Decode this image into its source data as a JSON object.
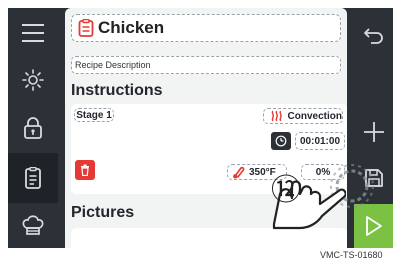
{
  "recipe": {
    "title": "Chicken",
    "description": "Recipe Description"
  },
  "instructions": {
    "heading": "Instructions",
    "stage_label": "Stage 1",
    "mode_label": "Convection",
    "time_value": "00:01:00",
    "temp_value": "350°F",
    "fan_value": "0%"
  },
  "pictures": {
    "heading": "Pictures"
  },
  "callout": {
    "number": "⑫"
  },
  "watermark": "VMC-TS-01680",
  "colors": {
    "background_dark": "#2c3138",
    "panel": "#f2f3f3",
    "accent_green": "#7bc143",
    "delete_red": "#e53935",
    "recipe_icon_red": "#e53935"
  },
  "icons": {
    "left_nav": [
      "menu-icon",
      "brightness-icon",
      "lock-icon",
      "recipe-book-icon",
      "chef-hat-icon"
    ],
    "right_nav": [
      "back-icon",
      "add-icon",
      "save-icon",
      "play-icon"
    ]
  }
}
